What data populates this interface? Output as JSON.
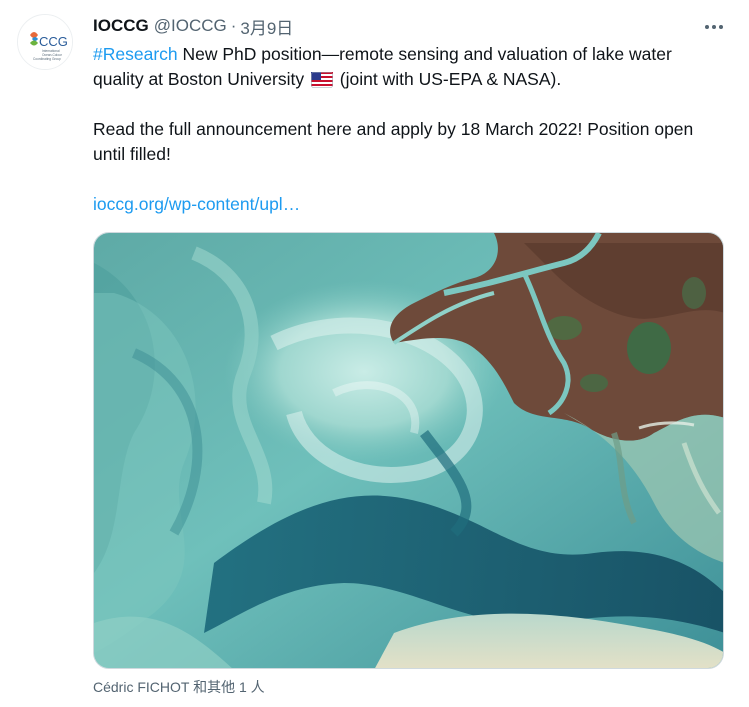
{
  "author": {
    "name": "IOCCG",
    "handle": "@IOCCG",
    "separator": "·",
    "date": "3月9日",
    "avatar": {
      "logo_text": "CCG",
      "sub_lines": [
        "International",
        "Ocean-Colour",
        "Coordinating Group"
      ]
    }
  },
  "more_icon": "more-horizontal-icon",
  "tweet": {
    "hashtag": "#Research",
    "line1_text": " New PhD position—remote sensing and valuation of lake water quality at Boston University ",
    "flag_icon": "us-flag-emoji",
    "line1_after_flag": " (joint with US-EPA & NASA).",
    "paragraph2": "Read the full announcement here and apply by 18 March 2022! Position open until filled!",
    "link": "ioccg.org/wp-content/upl…"
  },
  "media": {
    "kind": "satellite image of turquoise lake water with a river delta"
  },
  "tagged": "Cédric FICHOT 和其他 1 人",
  "colors": {
    "accent": "#1d9bf0",
    "text": "#0f1419",
    "secondary": "#536471",
    "border": "#cfd9de"
  }
}
